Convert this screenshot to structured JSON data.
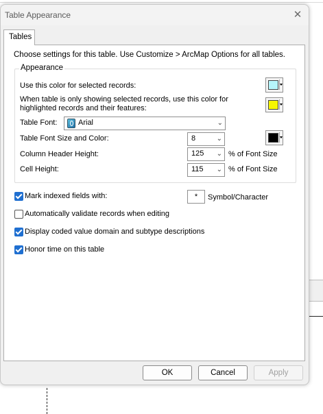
{
  "dialog": {
    "title": "Table Appearance",
    "close_glyph": "✕",
    "tab_label": "Tables",
    "intro": "Choose settings for this table. Use Customize > ArcMap Options for all tables."
  },
  "appearance": {
    "legend": "Appearance",
    "selected_color_label": "Use this color for selected records:",
    "selected_color": "#b6f6fb",
    "highlight_label_line1": "When table is only showing selected records, use this color for",
    "highlight_label_line2": "highlighted records and their features:",
    "highlight_color": "#f7f700",
    "font_label": "Table Font:",
    "font_value": "Arial",
    "font_size_label": "Table Font Size and Color:",
    "font_size_value": "8",
    "font_color": "#000000",
    "header_height_label": "Column Header Height:",
    "header_height_value": "125",
    "header_height_unit": "% of Font Size",
    "cell_height_label": "Cell Height:",
    "cell_height_value": "115",
    "cell_height_unit": "% of Font Size"
  },
  "options": {
    "mark_indexed_label": "Mark indexed fields with:",
    "mark_indexed_checked": true,
    "mark_symbol": "*",
    "mark_symbol_label": "Symbol/Character",
    "auto_validate_label": "Automatically validate records when editing",
    "auto_validate_checked": false,
    "coded_domain_label": "Display coded value domain and subtype descriptions",
    "coded_domain_checked": true,
    "honor_time_label": "Honor time on this table",
    "honor_time_checked": true
  },
  "buttons": {
    "ok": "OK",
    "cancel": "Cancel",
    "apply": "Apply"
  }
}
